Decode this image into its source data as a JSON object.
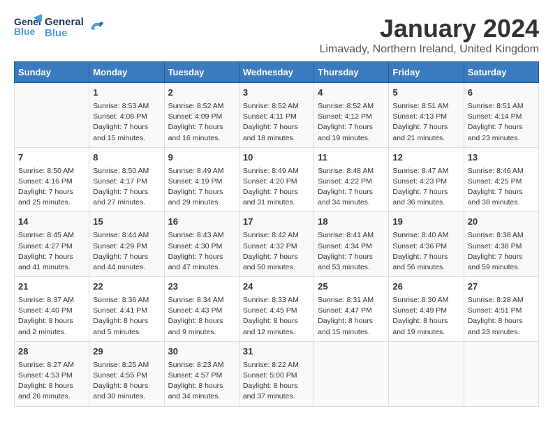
{
  "header": {
    "logo_general": "General",
    "logo_blue": "Blue",
    "month": "January 2024",
    "location": "Limavady, Northern Ireland, United Kingdom"
  },
  "columns": [
    "Sunday",
    "Monday",
    "Tuesday",
    "Wednesday",
    "Thursday",
    "Friday",
    "Saturday"
  ],
  "weeks": [
    [
      {
        "day": "",
        "sunrise": "",
        "sunset": "",
        "daylight": ""
      },
      {
        "day": "1",
        "sunrise": "Sunrise: 8:53 AM",
        "sunset": "Sunset: 4:08 PM",
        "daylight": "Daylight: 7 hours and 15 minutes."
      },
      {
        "day": "2",
        "sunrise": "Sunrise: 8:52 AM",
        "sunset": "Sunset: 4:09 PM",
        "daylight": "Daylight: 7 hours and 16 minutes."
      },
      {
        "day": "3",
        "sunrise": "Sunrise: 8:52 AM",
        "sunset": "Sunset: 4:11 PM",
        "daylight": "Daylight: 7 hours and 18 minutes."
      },
      {
        "day": "4",
        "sunrise": "Sunrise: 8:52 AM",
        "sunset": "Sunset: 4:12 PM",
        "daylight": "Daylight: 7 hours and 19 minutes."
      },
      {
        "day": "5",
        "sunrise": "Sunrise: 8:51 AM",
        "sunset": "Sunset: 4:13 PM",
        "daylight": "Daylight: 7 hours and 21 minutes."
      },
      {
        "day": "6",
        "sunrise": "Sunrise: 8:51 AM",
        "sunset": "Sunset: 4:14 PM",
        "daylight": "Daylight: 7 hours and 23 minutes."
      }
    ],
    [
      {
        "day": "7",
        "sunrise": "Sunrise: 8:50 AM",
        "sunset": "Sunset: 4:16 PM",
        "daylight": "Daylight: 7 hours and 25 minutes."
      },
      {
        "day": "8",
        "sunrise": "Sunrise: 8:50 AM",
        "sunset": "Sunset: 4:17 PM",
        "daylight": "Daylight: 7 hours and 27 minutes."
      },
      {
        "day": "9",
        "sunrise": "Sunrise: 8:49 AM",
        "sunset": "Sunset: 4:19 PM",
        "daylight": "Daylight: 7 hours and 29 minutes."
      },
      {
        "day": "10",
        "sunrise": "Sunrise: 8:49 AM",
        "sunset": "Sunset: 4:20 PM",
        "daylight": "Daylight: 7 hours and 31 minutes."
      },
      {
        "day": "11",
        "sunrise": "Sunrise: 8:48 AM",
        "sunset": "Sunset: 4:22 PM",
        "daylight": "Daylight: 7 hours and 34 minutes."
      },
      {
        "day": "12",
        "sunrise": "Sunrise: 8:47 AM",
        "sunset": "Sunset: 4:23 PM",
        "daylight": "Daylight: 7 hours and 36 minutes."
      },
      {
        "day": "13",
        "sunrise": "Sunrise: 8:46 AM",
        "sunset": "Sunset: 4:25 PM",
        "daylight": "Daylight: 7 hours and 38 minutes."
      }
    ],
    [
      {
        "day": "14",
        "sunrise": "Sunrise: 8:45 AM",
        "sunset": "Sunset: 4:27 PM",
        "daylight": "Daylight: 7 hours and 41 minutes."
      },
      {
        "day": "15",
        "sunrise": "Sunrise: 8:44 AM",
        "sunset": "Sunset: 4:29 PM",
        "daylight": "Daylight: 7 hours and 44 minutes."
      },
      {
        "day": "16",
        "sunrise": "Sunrise: 8:43 AM",
        "sunset": "Sunset: 4:30 PM",
        "daylight": "Daylight: 7 hours and 47 minutes."
      },
      {
        "day": "17",
        "sunrise": "Sunrise: 8:42 AM",
        "sunset": "Sunset: 4:32 PM",
        "daylight": "Daylight: 7 hours and 50 minutes."
      },
      {
        "day": "18",
        "sunrise": "Sunrise: 8:41 AM",
        "sunset": "Sunset: 4:34 PM",
        "daylight": "Daylight: 7 hours and 53 minutes."
      },
      {
        "day": "19",
        "sunrise": "Sunrise: 8:40 AM",
        "sunset": "Sunset: 4:36 PM",
        "daylight": "Daylight: 7 hours and 56 minutes."
      },
      {
        "day": "20",
        "sunrise": "Sunrise: 8:38 AM",
        "sunset": "Sunset: 4:38 PM",
        "daylight": "Daylight: 7 hours and 59 minutes."
      }
    ],
    [
      {
        "day": "21",
        "sunrise": "Sunrise: 8:37 AM",
        "sunset": "Sunset: 4:40 PM",
        "daylight": "Daylight: 8 hours and 2 minutes."
      },
      {
        "day": "22",
        "sunrise": "Sunrise: 8:36 AM",
        "sunset": "Sunset: 4:41 PM",
        "daylight": "Daylight: 8 hours and 5 minutes."
      },
      {
        "day": "23",
        "sunrise": "Sunrise: 8:34 AM",
        "sunset": "Sunset: 4:43 PM",
        "daylight": "Daylight: 8 hours and 9 minutes."
      },
      {
        "day": "24",
        "sunrise": "Sunrise: 8:33 AM",
        "sunset": "Sunset: 4:45 PM",
        "daylight": "Daylight: 8 hours and 12 minutes."
      },
      {
        "day": "25",
        "sunrise": "Sunrise: 8:31 AM",
        "sunset": "Sunset: 4:47 PM",
        "daylight": "Daylight: 8 hours and 15 minutes."
      },
      {
        "day": "26",
        "sunrise": "Sunrise: 8:30 AM",
        "sunset": "Sunset: 4:49 PM",
        "daylight": "Daylight: 8 hours and 19 minutes."
      },
      {
        "day": "27",
        "sunrise": "Sunrise: 8:28 AM",
        "sunset": "Sunset: 4:51 PM",
        "daylight": "Daylight: 8 hours and 23 minutes."
      }
    ],
    [
      {
        "day": "28",
        "sunrise": "Sunrise: 8:27 AM",
        "sunset": "Sunset: 4:53 PM",
        "daylight": "Daylight: 8 hours and 26 minutes."
      },
      {
        "day": "29",
        "sunrise": "Sunrise: 8:25 AM",
        "sunset": "Sunset: 4:55 PM",
        "daylight": "Daylight: 8 hours and 30 minutes."
      },
      {
        "day": "30",
        "sunrise": "Sunrise: 8:23 AM",
        "sunset": "Sunset: 4:57 PM",
        "daylight": "Daylight: 8 hours and 34 minutes."
      },
      {
        "day": "31",
        "sunrise": "Sunrise: 8:22 AM",
        "sunset": "Sunset: 5:00 PM",
        "daylight": "Daylight: 8 hours and 37 minutes."
      },
      {
        "day": "",
        "sunrise": "",
        "sunset": "",
        "daylight": ""
      },
      {
        "day": "",
        "sunrise": "",
        "sunset": "",
        "daylight": ""
      },
      {
        "day": "",
        "sunrise": "",
        "sunset": "",
        "daylight": ""
      }
    ]
  ]
}
